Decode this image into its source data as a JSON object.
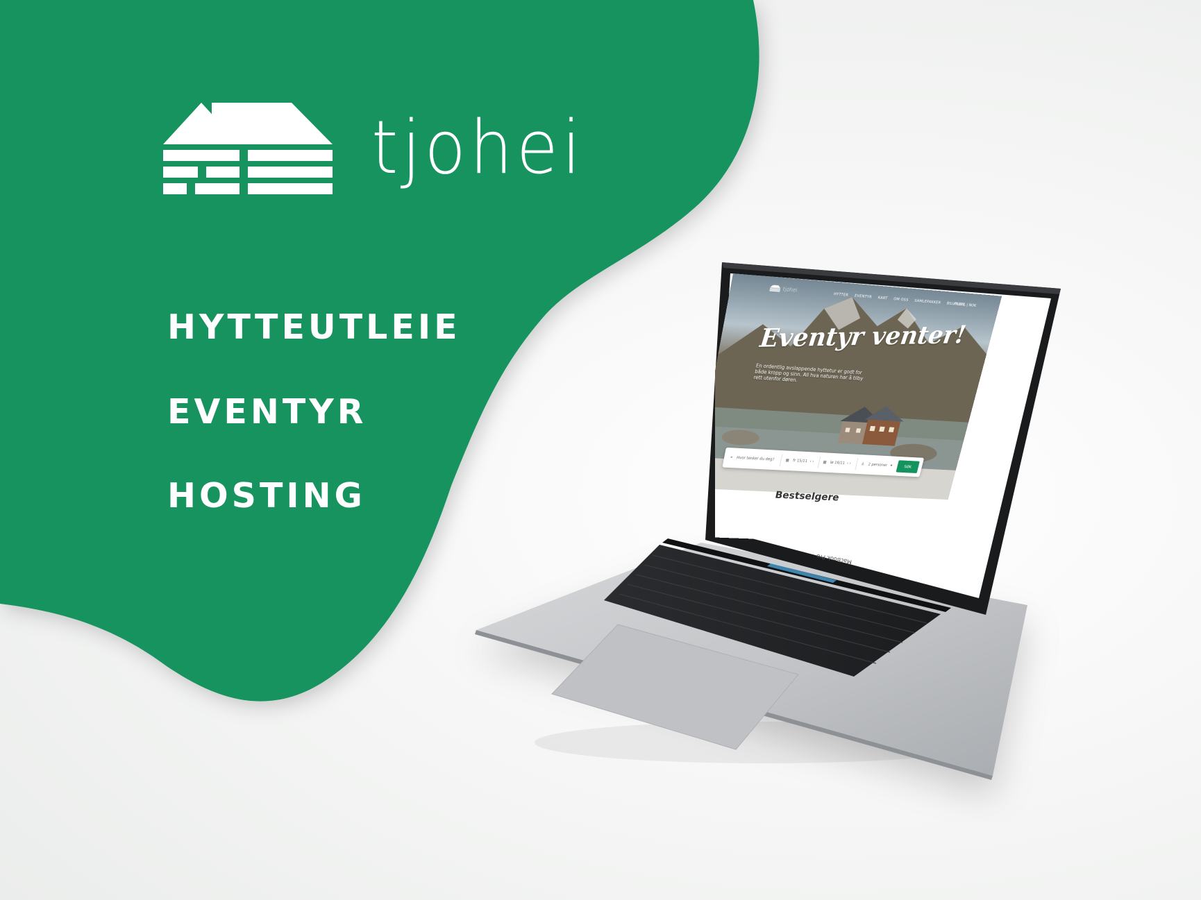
{
  "brand": {
    "name": "tjohei",
    "color": "#14935f"
  },
  "services": [
    "HYTTEUTLEIE",
    "EVENTYR",
    "HOSTING"
  ],
  "laptop": {
    "model_label": "MacBook Pro",
    "site": {
      "logo_text": "tjohei",
      "nav": [
        "HYTTER",
        "EVENTYR",
        "KART",
        "OM OSS",
        "SAMLEPAKKER",
        "BILUTLEIE"
      ],
      "nav_right": "PROFIL | NOK",
      "hero_title": "Eventyr venter!",
      "hero_text": "En ordentlig avslappende hyttetur er godt for både kropp og sinn. All hva naturen har å tilby rett utenfor døren.",
      "search": {
        "placeholder": "Hvor tenker du deg?",
        "date_from": "fr 15/11",
        "date_to": "lø 16/11",
        "guests": "2 personer",
        "button": "SØK"
      },
      "section_title": "Bestselgere"
    }
  }
}
